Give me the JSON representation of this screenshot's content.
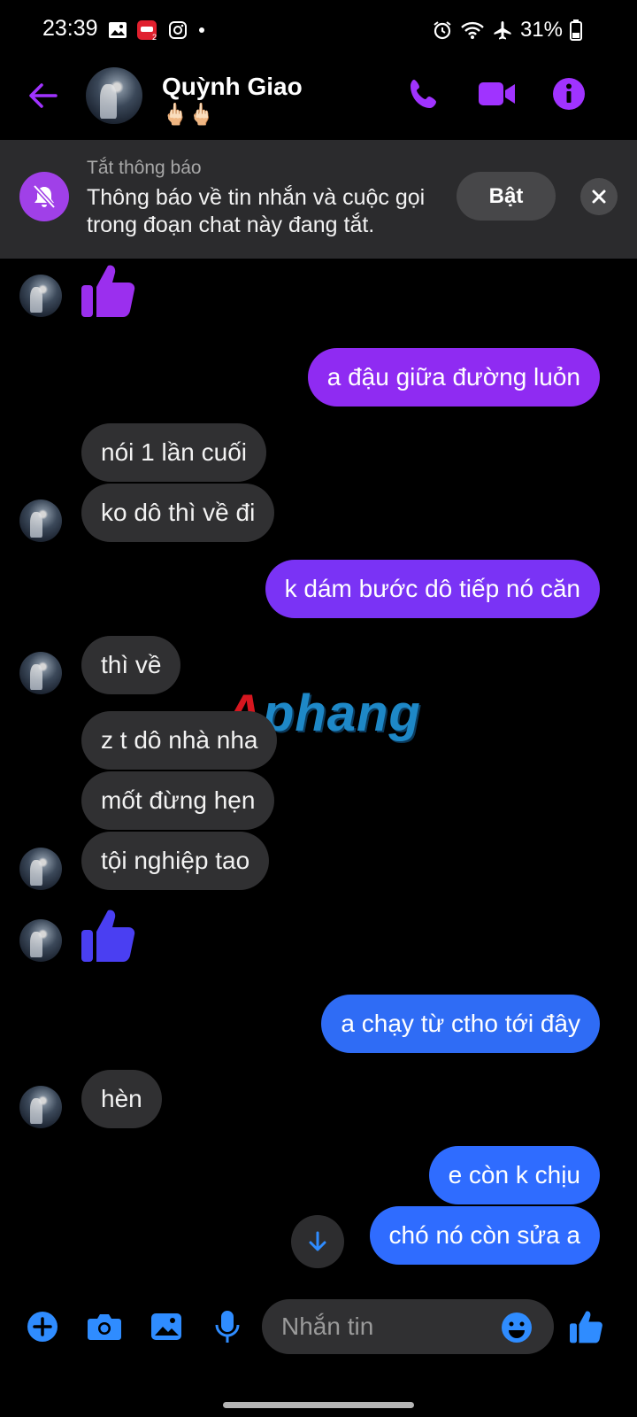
{
  "status_bar": {
    "time": "23:39",
    "battery": "31%"
  },
  "header": {
    "contact_name": "Quỳnh Giao",
    "status_emoji": "🖕🏻🖕🏻"
  },
  "banner": {
    "title": "Tắt thông báo",
    "text": "Thông báo về tin nhắn và cuộc gọi trong đoạn chat này đang tắt.",
    "turn_on_label": "Bật"
  },
  "messages": [
    {
      "from": "them",
      "type": "like"
    },
    {
      "from": "me",
      "text": "a đậu giữa đường luỏn"
    },
    {
      "from": "them",
      "text": "nói 1 lần cuối"
    },
    {
      "from": "them",
      "text": "ko dô thì về đi"
    },
    {
      "from": "me",
      "text": "k dám bước dô tiếp nó căn"
    },
    {
      "from": "them",
      "text": "thì về"
    },
    {
      "from": "them",
      "text": "z t dô nhà nha"
    },
    {
      "from": "them",
      "text": "mốt đừng hẹn"
    },
    {
      "from": "them",
      "text": "tội nghiệp tao"
    },
    {
      "from": "them",
      "type": "like"
    },
    {
      "from": "me",
      "text": "a chạy từ ctho tới đây"
    },
    {
      "from": "them",
      "text": "hèn"
    },
    {
      "from": "me",
      "text": "e còn k chịu"
    },
    {
      "from": "me",
      "text": "chó nó còn sửa a"
    }
  ],
  "watermark": {
    "text": "Aphang"
  },
  "composer": {
    "placeholder": "Nhắn tin"
  },
  "colors": {
    "accent": "#a033ff",
    "bubble_out_top": "#9b2bff",
    "bubble_out_bottom": "#2f6dff",
    "bubble_in": "#303032"
  }
}
